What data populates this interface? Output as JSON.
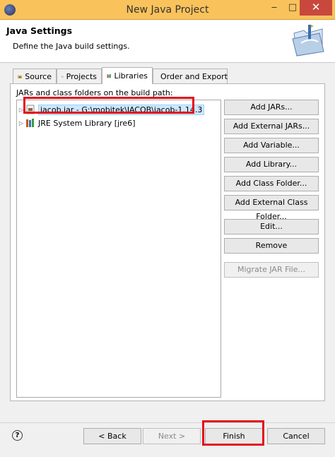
{
  "window": {
    "title": "New Java Project",
    "minimize_glyph": "‒",
    "maximize_glyph": "□",
    "close_glyph": "✕"
  },
  "banner": {
    "title": "Java Settings",
    "description": "Define the Java build settings."
  },
  "tabs": [
    {
      "label": "Source",
      "icon": "source-folder-icon",
      "active": false
    },
    {
      "label": "Projects",
      "icon": "projects-icon",
      "active": false
    },
    {
      "label": "Libraries",
      "icon": "libraries-icon",
      "active": true
    },
    {
      "label": "Order and Export",
      "icon": "order-export-icon",
      "active": false
    }
  ],
  "libraries": {
    "label": "JARs and class folders on the build path:",
    "items": [
      {
        "label": "jacob.jar - G:\\mobitek\\JACOB\\jacob-1.14.3",
        "icon": "jar-icon",
        "selected": true
      },
      {
        "label": "JRE System Library [jre6]",
        "icon": "library-icon",
        "selected": false
      }
    ],
    "buttons": [
      {
        "label": "Add JARs...",
        "enabled": true
      },
      {
        "label": "Add External JARs...",
        "enabled": true
      },
      {
        "label": "Add Variable...",
        "enabled": true
      },
      {
        "label": "Add Library...",
        "enabled": true
      },
      {
        "label": "Add Class Folder...",
        "enabled": true
      },
      {
        "label": "Add External Class Folder...",
        "enabled": true
      },
      {
        "label": "Edit...",
        "enabled": true
      },
      {
        "label": "Remove",
        "enabled": true
      },
      {
        "label": "Migrate JAR File...",
        "enabled": false
      }
    ]
  },
  "footer": {
    "help_glyph": "?",
    "back_label": "< Back",
    "next_label": "Next >",
    "finish_label": "Finish",
    "cancel_label": "Cancel"
  },
  "colors": {
    "titlebar": "#f9c25b",
    "close_button": "#c9483e",
    "highlight": "#e3101d",
    "selection": "#cde8ff"
  }
}
